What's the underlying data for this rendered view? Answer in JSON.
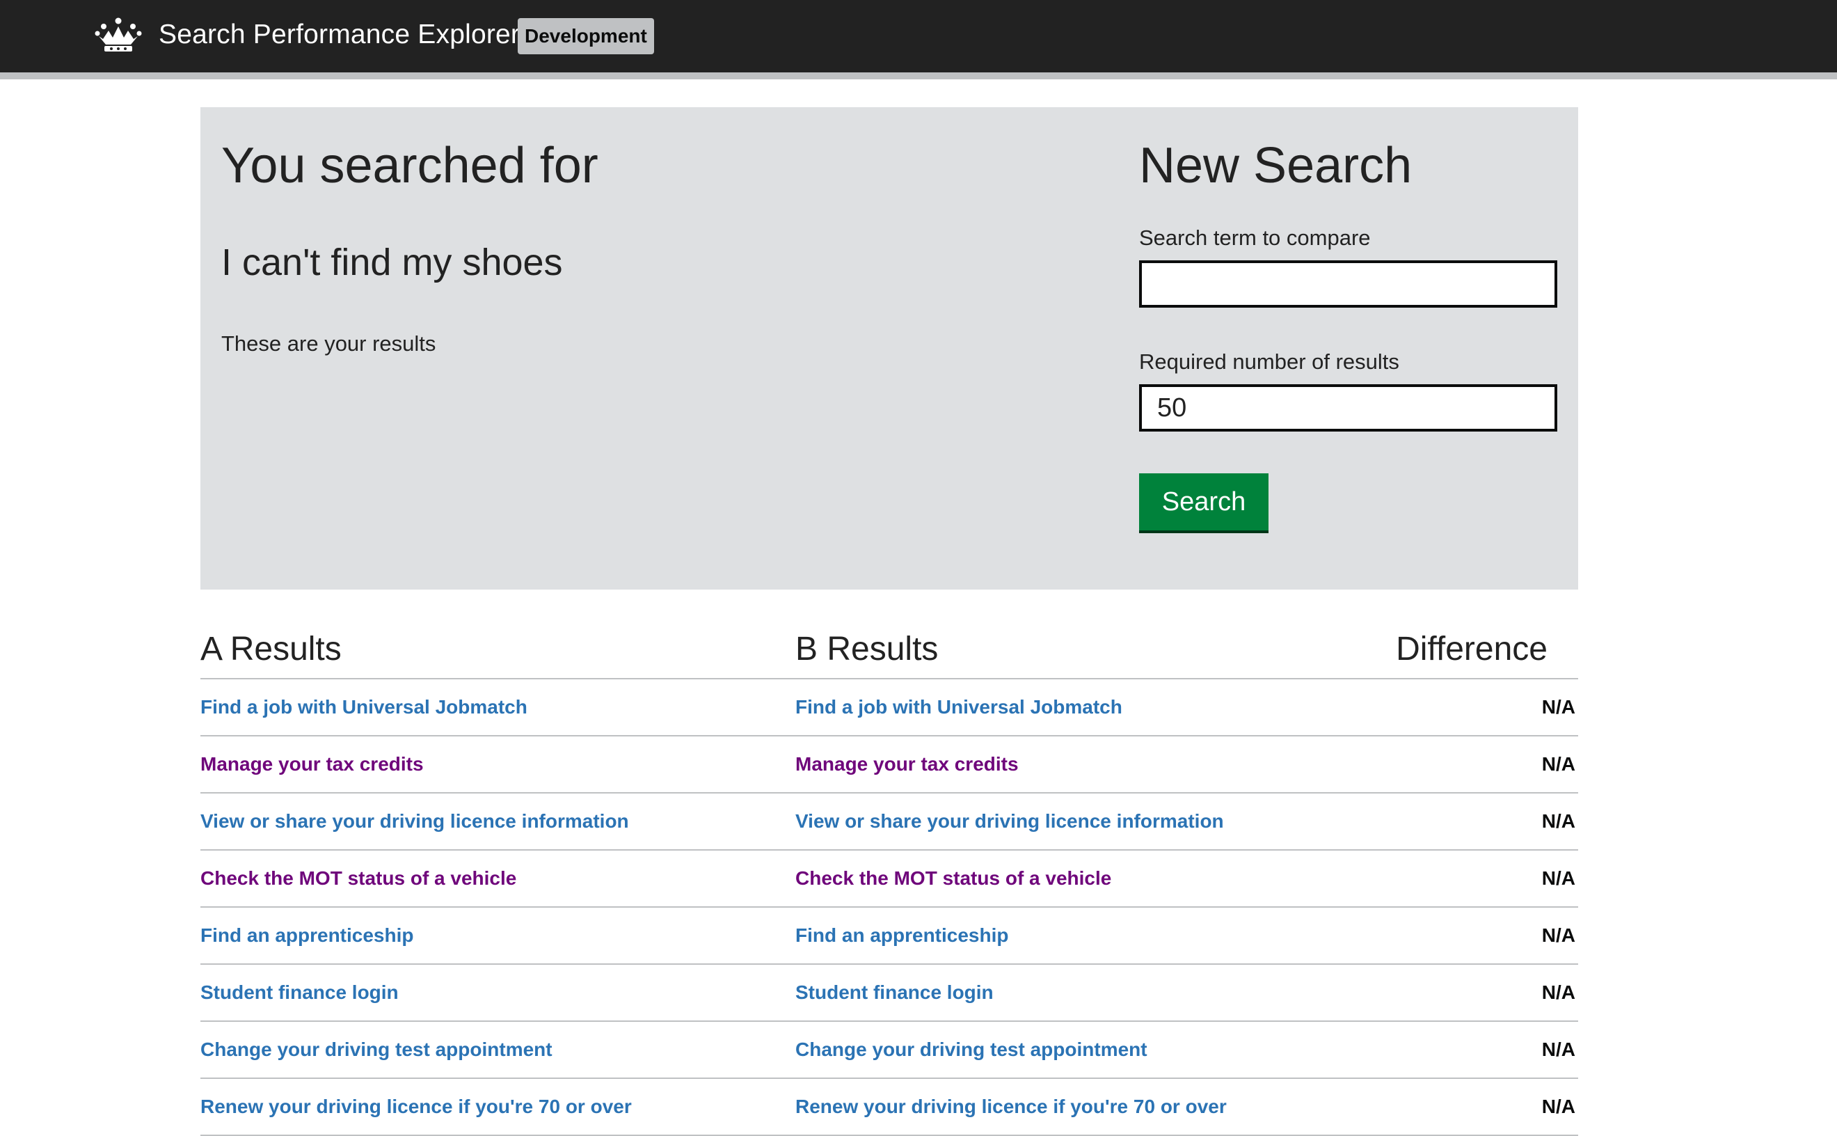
{
  "header": {
    "app_title": "Search Performance Explorer",
    "phase_tag": "Development",
    "logo_icon": "crown-icon"
  },
  "search_panel": {
    "heading": "You searched for",
    "query": "I can't find my shoes",
    "note": "These are your results",
    "new_search_heading": "New Search",
    "term_label": "Search term to compare",
    "term_value": "",
    "count_label": "Required number of results",
    "count_value": "50",
    "search_button": "Search"
  },
  "results": {
    "col_a": "A Results",
    "col_b": "B Results",
    "col_diff": "Difference",
    "link_color": "#2b73b4",
    "visited_color": "#6f067b",
    "rows": [
      {
        "a": "Find a job with Universal Jobmatch",
        "b": "Find a job with Universal Jobmatch",
        "diff": "N/A",
        "visited": false
      },
      {
        "a": "Manage your tax credits",
        "b": "Manage your tax credits",
        "diff": "N/A",
        "visited": true
      },
      {
        "a": "View or share your driving licence information",
        "b": "View or share your driving licence information",
        "diff": "N/A",
        "visited": false
      },
      {
        "a": "Check the MOT status of a vehicle",
        "b": "Check the MOT status of a vehicle",
        "diff": "N/A",
        "visited": true
      },
      {
        "a": "Find an apprenticeship",
        "b": "Find an apprenticeship",
        "diff": "N/A",
        "visited": false
      },
      {
        "a": "Student finance login",
        "b": "Student finance login",
        "diff": "N/A",
        "visited": false
      },
      {
        "a": "Change your driving test appointment",
        "b": "Change your driving test appointment",
        "diff": "N/A",
        "visited": false
      },
      {
        "a": "Renew your driving licence if you're 70 or over",
        "b": "Renew your driving licence if you're 70 or over",
        "diff": "N/A",
        "visited": false
      }
    ]
  }
}
